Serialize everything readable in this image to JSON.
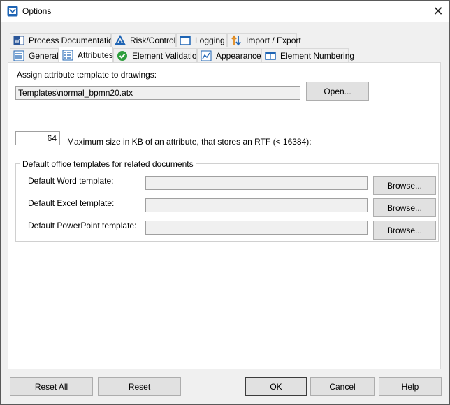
{
  "window": {
    "title": "Options",
    "close_glyph": "✕",
    "icon": "app-icon"
  },
  "tabs_row1": [
    {
      "label": "Process Documentation",
      "icon": "word-document-icon"
    },
    {
      "label": "Risk/Control",
      "icon": "triangle-cycle-icon"
    },
    {
      "label": "Logging",
      "icon": "log-window-icon"
    },
    {
      "label": "Import / Export",
      "icon": "up-down-arrows-icon"
    }
  ],
  "tabs_row2": [
    {
      "label": "General",
      "icon": "list-icon"
    },
    {
      "label": "Attributes",
      "icon": "attributes-list-icon",
      "active": true
    },
    {
      "label": "Element Validation",
      "icon": "green-check-icon"
    },
    {
      "label": "Appearance",
      "icon": "appearance-icon"
    },
    {
      "label": "Element Numbering",
      "icon": "numbering-icon"
    }
  ],
  "attributes": {
    "assign_label": "Assign attribute template to drawings:",
    "template_path": "Templates\\normal_bpmn20.atx",
    "open_button": "Open...",
    "max_size_value": "64",
    "max_size_label": "Maximum size in KB of an attribute, that stores an RTF (< 16384):",
    "group_title": "Default office templates for related documents",
    "word_label": "Default Word template:",
    "word_value": "",
    "excel_label": "Default Excel template:",
    "excel_value": "",
    "ppt_label": "Default PowerPoint template:",
    "ppt_value": "",
    "browse_button": "Browse..."
  },
  "footer": {
    "reset_all": "Reset All",
    "reset": "Reset",
    "ok": "OK",
    "cancel": "Cancel",
    "help": "Help"
  },
  "colors": {
    "accent": "#1e64b4",
    "check_green": "#2e9e3e",
    "arrow_orange": "#e08a1e"
  }
}
